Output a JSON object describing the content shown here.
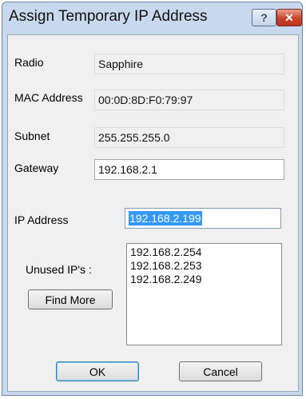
{
  "window": {
    "title": "Assign Temporary IP Address",
    "help_glyph": "?",
    "close_glyph": "✕"
  },
  "fields": {
    "radio": {
      "label": "Radio",
      "value": "Sapphire"
    },
    "mac": {
      "label": "MAC Address",
      "value": "00:0D:8D:F0:79:97"
    },
    "subnet": {
      "label": "Subnet",
      "value": "255.255.255.0"
    },
    "gateway": {
      "label": "Gateway",
      "value": "192.168.2.1"
    },
    "ip": {
      "label": "IP Address",
      "value": "192.168.2.199"
    }
  },
  "unused": {
    "label": "Unused IP's :",
    "items": [
      "192.168.2.254",
      "192.168.2.253",
      "192.168.2.249"
    ],
    "find_more": "Find More"
  },
  "buttons": {
    "ok": "OK",
    "cancel": "Cancel"
  }
}
